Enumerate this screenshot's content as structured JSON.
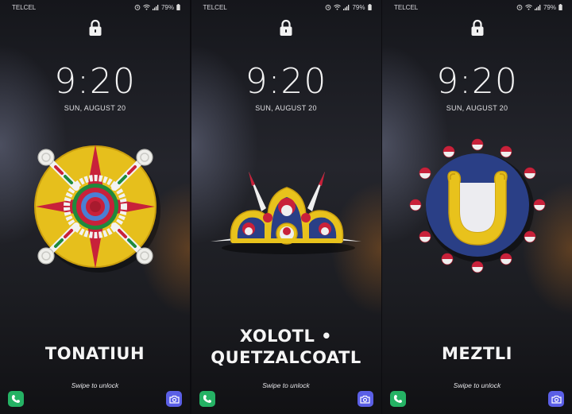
{
  "screens": [
    {
      "carrier": "TELCEL",
      "battery": "79%",
      "time": "9:20",
      "date": "SUN, AUGUST 20",
      "title_lines": [
        "TONATIUH"
      ],
      "swipe_hint": "Swipe to unlock",
      "artwork": "sun-emblem"
    },
    {
      "carrier": "TELCEL",
      "battery": "79%",
      "time": "9:20",
      "date": "SUN, AUGUST 20",
      "title_lines": [
        "XOLOTL •",
        "QUETZALCOATL"
      ],
      "swipe_hint": "Swipe to unlock",
      "artwork": "crown-emblem"
    },
    {
      "carrier": "TELCEL",
      "battery": "79%",
      "time": "9:20",
      "date": "SUN, AUGUST 20",
      "title_lines": [
        "MEZTLI"
      ],
      "swipe_hint": "Swipe to unlock",
      "artwork": "moon-emblem"
    }
  ],
  "icons": {
    "status": [
      "alarm-icon",
      "wifi-icon",
      "signal-icon",
      "battery-icon"
    ],
    "lock": "lock-icon",
    "phone_shortcut": "phone-icon",
    "camera_shortcut": "camera-icon"
  },
  "colors": {
    "phone_shortcut": "#25b264",
    "camera_shortcut": "#5b5fe6",
    "emblem_yellow": "#e8c21c",
    "emblem_red": "#c8213a",
    "emblem_green": "#1f8a3c",
    "emblem_blue": "#2a3f86"
  }
}
